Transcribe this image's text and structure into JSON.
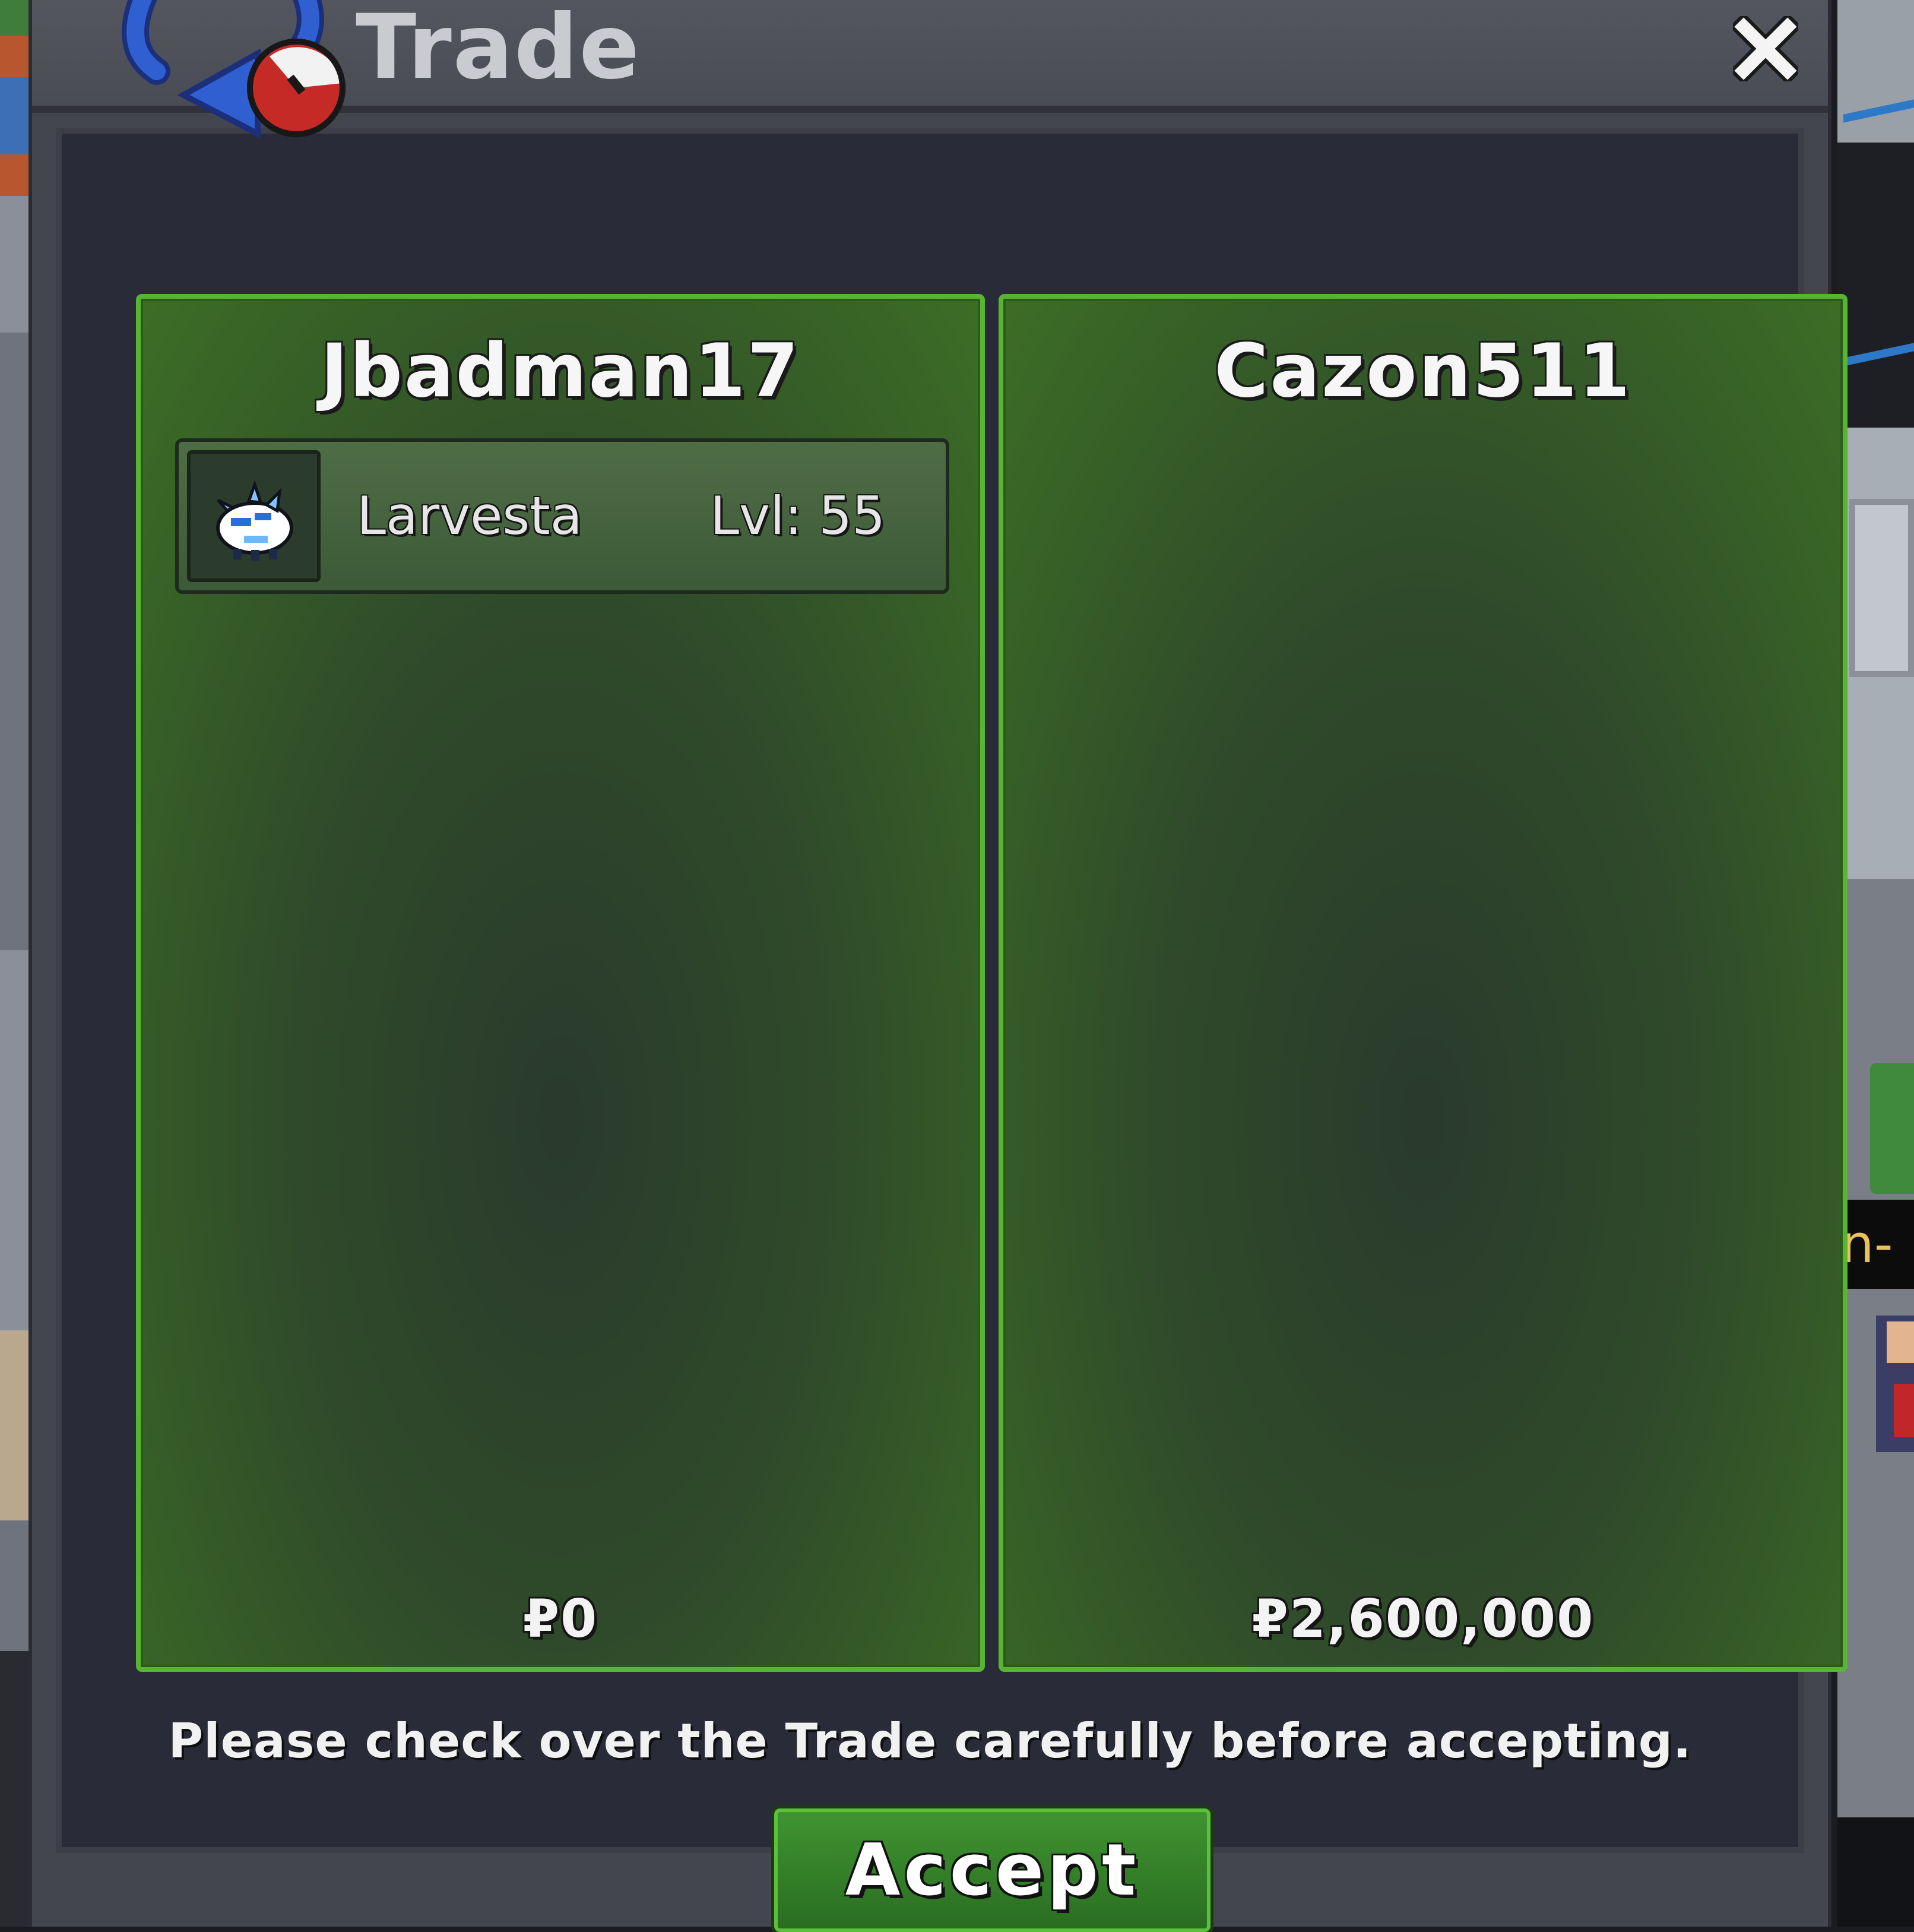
{
  "window": {
    "title": "Trade",
    "close_icon": "close-icon"
  },
  "panels": [
    {
      "player_name": "Jbadman17",
      "pokemon": [
        {
          "icon": "larvesta-sprite-icon",
          "name": "Larvesta",
          "level_text": "Lvl: 55"
        }
      ],
      "money_text": "₽0"
    },
    {
      "player_name": "Cazon511",
      "pokemon": [],
      "money_text": "₽2,600,000"
    }
  ],
  "footer": {
    "notice": "Please check over the Trade carefully before accepting.",
    "accept_label": "Accept"
  },
  "background": {
    "name_tag_fragment": "n-T"
  },
  "colors": {
    "panel_border": "#58b531",
    "panel_fill": "#2f4a2a",
    "accept_fill": "#3f9430",
    "window": "#43454f"
  }
}
